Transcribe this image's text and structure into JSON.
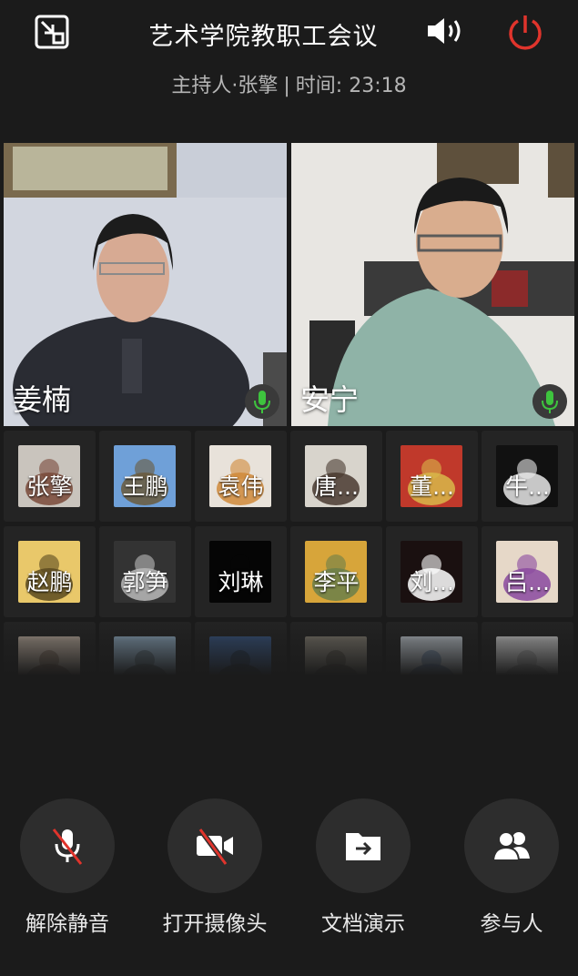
{
  "header": {
    "title": "艺术学院教职工会议",
    "host_label": "主持人·张擎",
    "separator": "|",
    "time_label": "时间: 23:18"
  },
  "videos": [
    {
      "name": "姜楠"
    },
    {
      "name": "安宁"
    }
  ],
  "participants": [
    {
      "name": "张擎"
    },
    {
      "name": "王鹏"
    },
    {
      "name": "袁伟"
    },
    {
      "name": "唐..."
    },
    {
      "name": "董..."
    },
    {
      "name": "牛..."
    },
    {
      "name": "赵鹏"
    },
    {
      "name": "郭笋"
    },
    {
      "name": "刘琳"
    },
    {
      "name": "李平"
    },
    {
      "name": "刘..."
    },
    {
      "name": "吕..."
    },
    {
      "name": ""
    },
    {
      "name": ""
    },
    {
      "name": ""
    },
    {
      "name": ""
    },
    {
      "name": ""
    },
    {
      "name": ""
    }
  ],
  "controls": {
    "unmute": "解除静音",
    "camera": "打开摄像头",
    "share_doc": "文档演示",
    "participants": "参与人"
  },
  "colors": {
    "background": "#1b1b1b",
    "power": "#e0342c",
    "mic_active": "#3ec43e",
    "muted_slash": "#e0342c"
  }
}
